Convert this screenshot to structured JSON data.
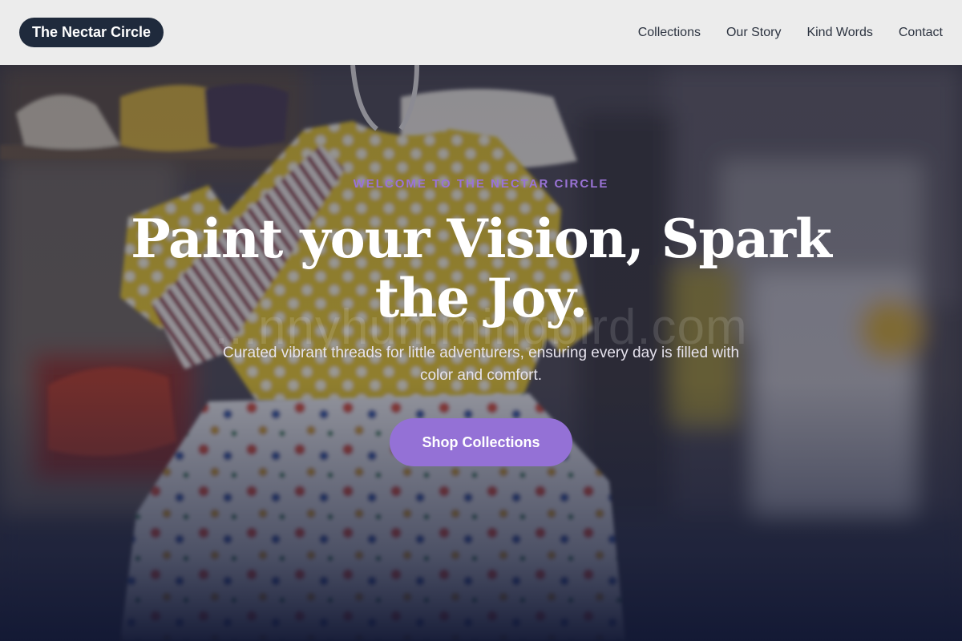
{
  "header": {
    "brand": "The Nectar Circle",
    "nav": [
      {
        "label": "Collections"
      },
      {
        "label": "Our Story"
      },
      {
        "label": "Kind Words"
      },
      {
        "label": "Contact"
      }
    ]
  },
  "hero": {
    "eyebrow": "WELCOME TO THE NECTAR CIRCLE",
    "headline": "Paint your Vision, Spark the Joy.",
    "subtext": "Curated vibrant threads for little adventurers, ensuring every day is filled with color and comfort.",
    "cta_label": "Shop Collections",
    "watermark": "...nnyhummingbird.com",
    "background_image": "blurred photo of children's clothing on hangers: yellow polka-dot dress with red and white striped sleeves, white bug-print dress, kids' shoes on a shelf"
  },
  "colors": {
    "accent": "#9471d6",
    "eyebrow": "#9a73d6",
    "brand_bg": "#1f2a3c",
    "header_bg": "#ececec"
  }
}
